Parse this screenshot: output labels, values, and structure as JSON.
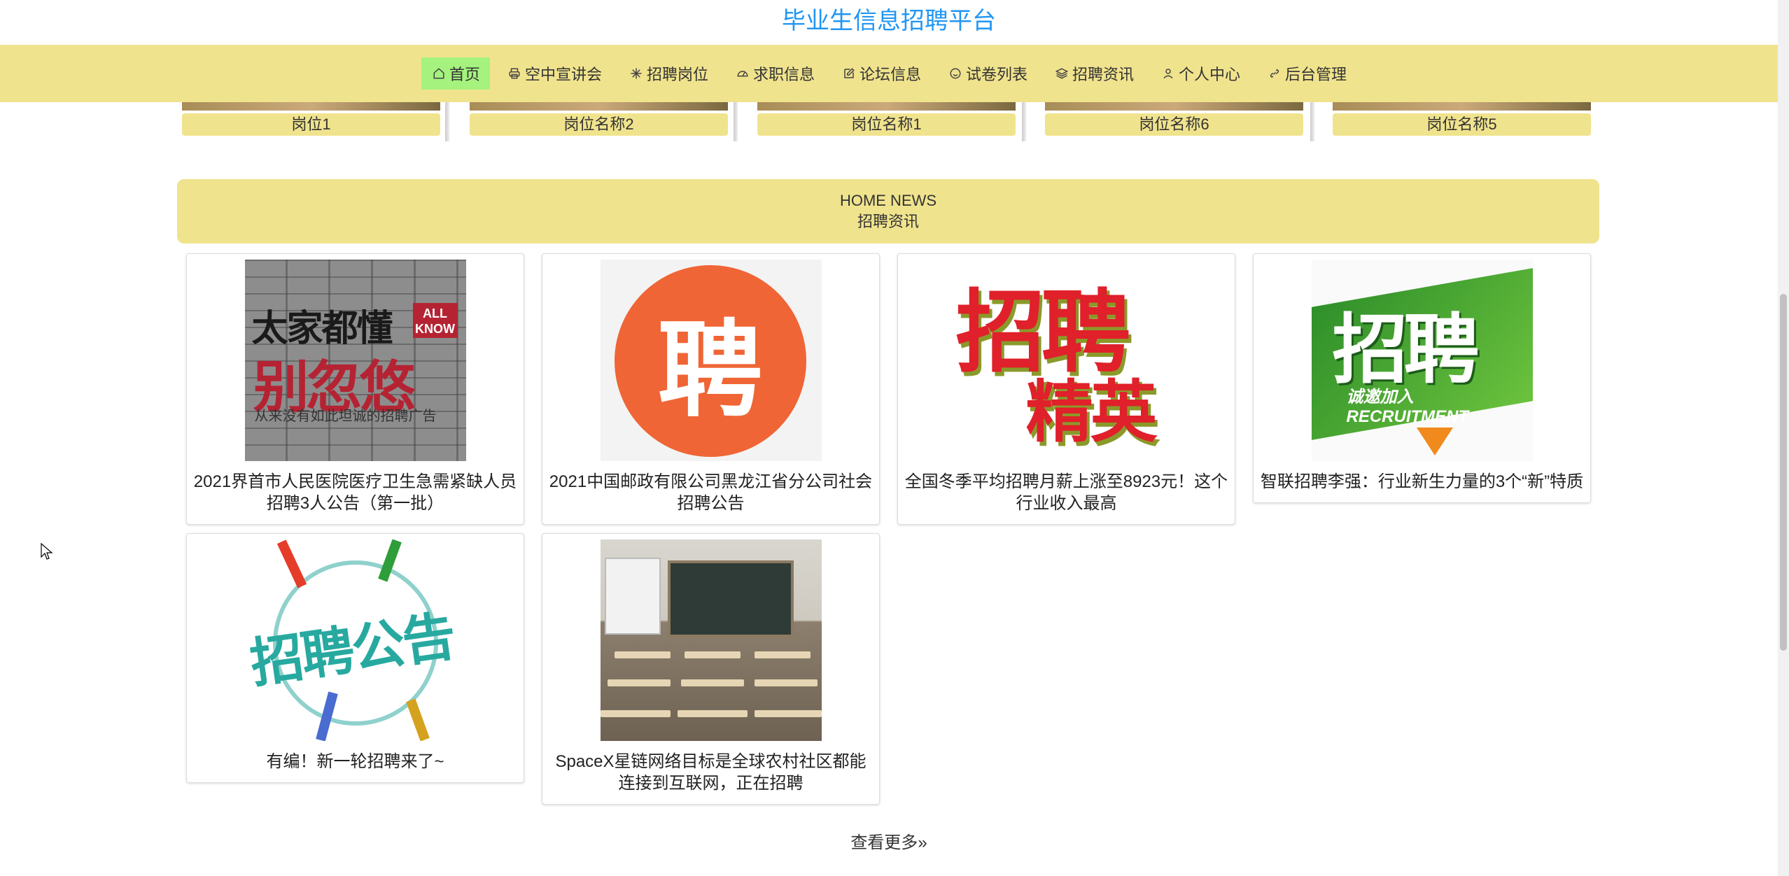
{
  "site": {
    "title": "毕业生信息招聘平台"
  },
  "nav": {
    "items": [
      {
        "label": "首页",
        "icon": "home-icon",
        "active": true
      },
      {
        "label": "空中宣讲会",
        "icon": "print-icon",
        "active": false
      },
      {
        "label": "招聘岗位",
        "icon": "snowflake-icon",
        "active": false
      },
      {
        "label": "求职信息",
        "icon": "gauge-icon",
        "active": false
      },
      {
        "label": "论坛信息",
        "icon": "edit-icon",
        "active": false
      },
      {
        "label": "试卷列表",
        "icon": "smile-icon",
        "active": false
      },
      {
        "label": "招聘资讯",
        "icon": "layers-icon",
        "active": false
      },
      {
        "label": "个人中心",
        "icon": "user-icon",
        "active": false
      },
      {
        "label": "后台管理",
        "icon": "link-icon",
        "active": false
      }
    ]
  },
  "jobs": [
    {
      "label": "岗位1"
    },
    {
      "label": "岗位名称2"
    },
    {
      "label": "岗位名称1"
    },
    {
      "label": "岗位名称6"
    },
    {
      "label": "岗位名称5"
    }
  ],
  "news_section": {
    "heading_en": "HOME NEWS",
    "heading_zh": "招聘资讯"
  },
  "news": [
    {
      "title": "2021界首市人民医院医疗卫生急需紧缺人员招聘3人公告（第一批）",
      "image_text": [
        "太家都懂",
        "别忽悠",
        "ALL KNOW",
        "从来没有如此坦诚的招聘广告"
      ]
    },
    {
      "title": "2021中国邮政有限公司黑龙江省分公司社会招聘公告",
      "image_text": [
        "聘"
      ]
    },
    {
      "title": "全国冬季平均招聘月薪上涨至8923元！这个行业收入最高",
      "image_text": [
        "招聘",
        "精英"
      ]
    },
    {
      "title": "智联招聘李强：行业新生力量的3个“新”特质",
      "image_text": [
        "招聘",
        "诚邀加入 RECRUITMENT"
      ]
    },
    {
      "title": "有编！新一轮招聘来了~",
      "image_text": [
        "招聘公告"
      ]
    },
    {
      "title": "SpaceX星链网络目标是全球农村社区都能连接到互联网，正在招聘",
      "image_text": []
    }
  ],
  "more": {
    "label": "查看更多"
  },
  "colors": {
    "accent_yellow": "#f0e38d",
    "active_green": "#a5f27e",
    "title_blue": "#2196f3"
  }
}
